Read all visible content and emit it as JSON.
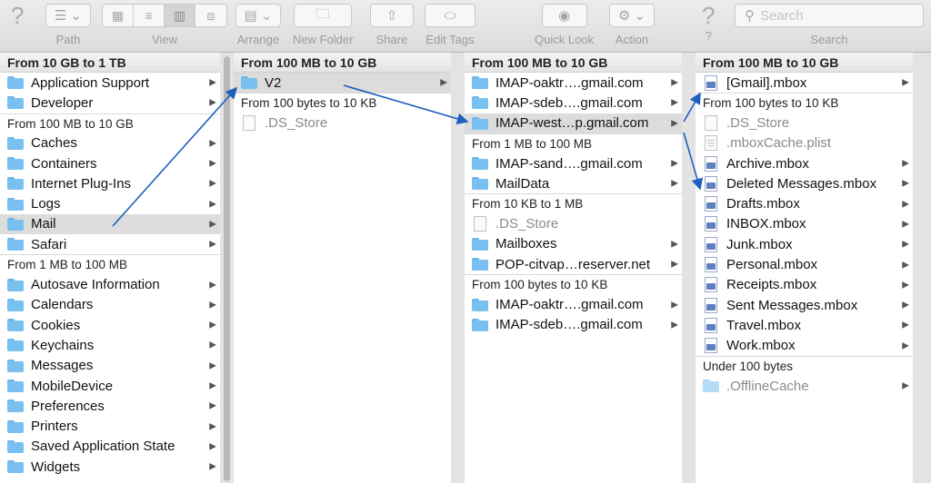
{
  "toolbar": {
    "help_label": "",
    "path_label": "Path",
    "view_label": "View",
    "arrange_label": "Arrange",
    "new_folder_label": "New Folder",
    "share_label": "Share",
    "edit_tags_label": "Edit Tags",
    "quick_look_label": "Quick Look",
    "action_label": "Action",
    "help2_label": "?",
    "search_label": "Search",
    "search_placeholder": "Search"
  },
  "col1": {
    "s1": "From 10 GB to 1 TB",
    "i1": "Application Support",
    "i2": "Developer",
    "s2": "From 100 MB to 10 GB",
    "i3": "Caches",
    "i4": "Containers",
    "i5": "Internet Plug-Ins",
    "i6": "Logs",
    "i7": "Mail",
    "i8": "Safari",
    "s3": "From 1 MB to 100 MB",
    "i9": "Autosave Information",
    "i10": "Calendars",
    "i11": "Cookies",
    "i12": "Keychains",
    "i13": "Messages",
    "i14": "MobileDevice",
    "i15": "Preferences",
    "i16": "Printers",
    "i17": "Saved Application State",
    "i18": "Widgets"
  },
  "col2": {
    "s1": "From 100 MB to 10 GB",
    "i1": "V2",
    "s2": "From 100 bytes to 10 KB",
    "i2": ".DS_Store"
  },
  "col3": {
    "s1": "From 100 MB to 10 GB",
    "i1": "IMAP-oaktr….gmail.com",
    "i2": "IMAP-sdeb….gmail.com",
    "i3": "IMAP-west…p.gmail.com",
    "s2": "From 1 MB to 100 MB",
    "i4": "IMAP-sand….gmail.com",
    "i5": "MailData",
    "s3": "From 10 KB to 1 MB",
    "i6": ".DS_Store",
    "i7": "Mailboxes",
    "i8": "POP-citvap…reserver.net",
    "s4": "From 100 bytes to 10 KB",
    "i9": "IMAP-oaktr….gmail.com",
    "i10": "IMAP-sdeb….gmail.com"
  },
  "col4": {
    "s1": "From 100 MB to 10 GB",
    "i1": "[Gmail].mbox",
    "s2": "From 100 bytes to 10 KB",
    "i2": ".DS_Store",
    "i3": ".mboxCache.plist",
    "i4": "Archive.mbox",
    "i5": "Deleted Messages.mbox",
    "i6": "Drafts.mbox",
    "i7": "INBOX.mbox",
    "i8": "Junk.mbox",
    "i9": "Personal.mbox",
    "i10": "Receipts.mbox",
    "i11": "Sent Messages.mbox",
    "i12": "Travel.mbox",
    "i13": "Work.mbox",
    "s3": "Under 100 bytes",
    "i14": ".OfflineCache"
  },
  "colors": {
    "arrow": "#1f5fbf",
    "folder": "#78c0f0",
    "selection": "#dcdcdc"
  },
  "icons": [
    "help-icon",
    "path-icon",
    "view-icons",
    "arrange-icon",
    "new-folder-icon",
    "share-icon",
    "tag-icon",
    "eye-icon",
    "gear-icon",
    "search-icon",
    "folder-icon",
    "document-icon",
    "mbox-icon",
    "chevron-right-icon"
  ]
}
